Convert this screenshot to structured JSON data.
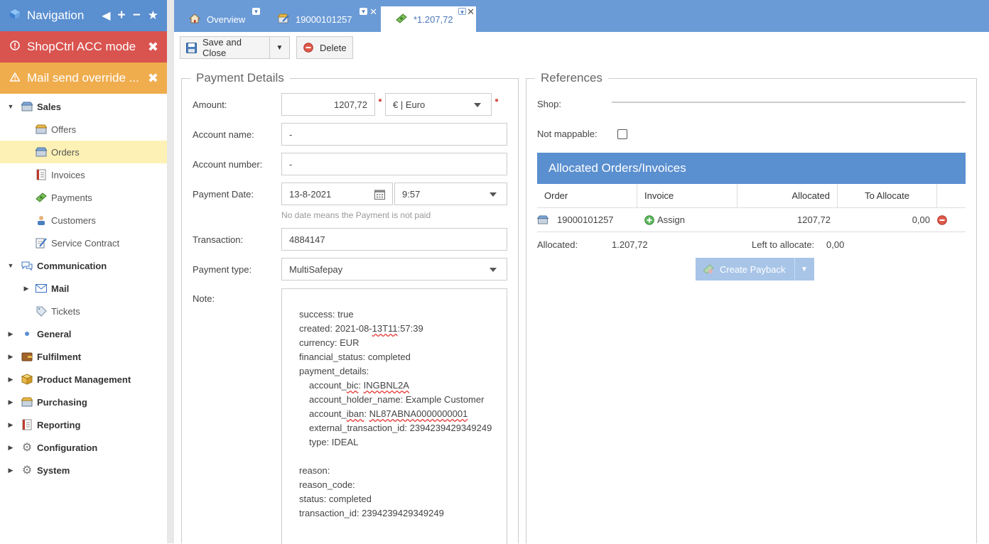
{
  "sidebar": {
    "nav_title": "Navigation",
    "acc_title": "ShopCtrl ACC mode",
    "mail_title": "Mail send override ...",
    "items": [
      {
        "label": "Sales"
      },
      {
        "label": "Offers"
      },
      {
        "label": "Orders"
      },
      {
        "label": "Invoices"
      },
      {
        "label": "Payments"
      },
      {
        "label": "Customers"
      },
      {
        "label": "Service Contract"
      },
      {
        "label": "Communication"
      },
      {
        "label": "Mail"
      },
      {
        "label": "Tickets"
      },
      {
        "label": "General"
      },
      {
        "label": "Fulfilment"
      },
      {
        "label": "Product Management"
      },
      {
        "label": "Purchasing"
      },
      {
        "label": "Reporting"
      },
      {
        "label": "Configuration"
      },
      {
        "label": "System"
      }
    ]
  },
  "tabs": [
    {
      "label": "Overview"
    },
    {
      "label": "19000101257"
    },
    {
      "label": "*1.207,72"
    }
  ],
  "toolbar": {
    "save_label": "Save and Close",
    "delete_label": "Delete"
  },
  "payment_details": {
    "legend": "Payment Details",
    "amount_label": "Amount:",
    "amount_value": "1207,72",
    "currency_value": "€ | Euro",
    "account_name_label": "Account name:",
    "account_name_value": "-",
    "account_number_label": "Account number:",
    "account_number_value": "-",
    "payment_date_label": "Payment Date:",
    "payment_date_value": "13-8-2021",
    "payment_time_value": "9:57",
    "date_hint": "No date means the Payment is not paid",
    "transaction_label": "Transaction:",
    "transaction_value": "4884147",
    "payment_type_label": "Payment type:",
    "payment_type_value": "MultiSafepay",
    "note_label": "Note:"
  },
  "note": {
    "success": "success: true",
    "created_a": "created: 2021-08-",
    "created_b": "13T11",
    "created_c": ":57:39",
    "currency": "currency: EUR",
    "financial_status": "financial_status: completed",
    "payment_details": "payment_details:",
    "bic_a": "account_",
    "bic_b": "bic",
    "bic_c": ": ",
    "bic_d": "INGBNL2A",
    "holder": "account_holder_name: Example Customer",
    "iban_a": "account_",
    "iban_b": "iban",
    "iban_c": ": ",
    "iban_d": "NL87ABNA0000000001",
    "external": "external_transaction_id: 2394239429349249",
    "type": "type: IDEAL",
    "reason": "reason:",
    "reason_code": "reason_code:",
    "status": "status: completed",
    "transaction_id": "transaction_id: 2394239429349249"
  },
  "references": {
    "legend": "References",
    "shop_label": "Shop:",
    "not_mappable_label": "Not mappable:",
    "alloc_title": "Allocated Orders/Invoices",
    "columns": [
      "Order",
      "Invoice",
      "Allocated",
      "To Allocate"
    ],
    "row": {
      "order": "19000101257",
      "invoice": "Assign",
      "allocated": "1207,72",
      "to_allocate": "0,00"
    },
    "allocated_label": "Allocated:",
    "allocated_value": "1.207,72",
    "left_label": "Left to allocate:",
    "left_value": "0,00",
    "payback_label": "Create Payback"
  }
}
